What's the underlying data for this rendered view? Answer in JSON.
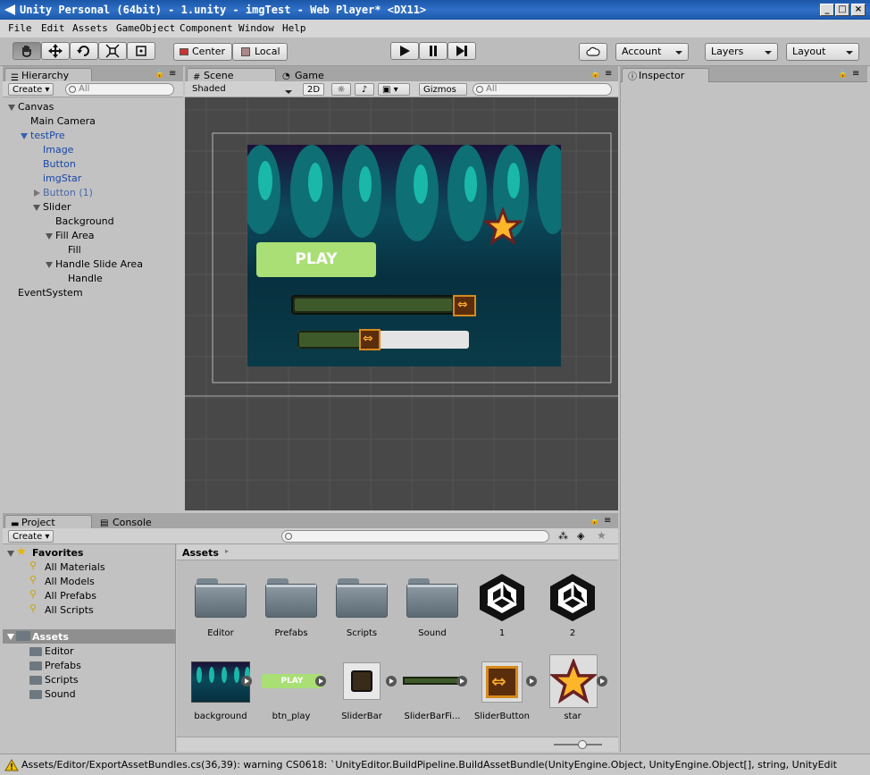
{
  "window": {
    "title": "Unity Personal (64bit) - 1.unity - imgTest - Web Player* <DX11>"
  },
  "menu": [
    "File",
    "Edit",
    "Assets",
    "GameObject",
    "Component",
    "Window",
    "Help"
  ],
  "toolbar": {
    "center": "Center",
    "local": "Local",
    "account": "Account",
    "layers": "Layers",
    "layout": "Layout"
  },
  "hierarchy": {
    "tab": "Hierarchy",
    "create": "Create",
    "search_placeholder": "All",
    "items": [
      "Canvas",
      "Main Camera",
      "testPre",
      "Image",
      "Button",
      "imgStar",
      "Button (1)",
      "Slider",
      "Background",
      "Fill Area",
      "Fill",
      "Handle Slide Area",
      "Handle",
      "EventSystem"
    ]
  },
  "scene": {
    "tab_scene": "Scene",
    "tab_game": "Game",
    "shading": "Shaded",
    "mode2d": "2D",
    "gizmos": "Gizmos",
    "search_placeholder": "All",
    "play_label": "PLAY"
  },
  "inspector": {
    "tab": "Inspector"
  },
  "project": {
    "tab_project": "Project",
    "tab_console": "Console",
    "create": "Create",
    "favorites_label": "Favorites",
    "favorites": [
      "All Materials",
      "All Models",
      "All Prefabs",
      "All Scripts"
    ],
    "assets_label": "Assets",
    "asset_folders": [
      "Editor",
      "Prefabs",
      "Scripts",
      "Sound"
    ],
    "breadcrumb": "Assets",
    "assets_row1": [
      "Editor",
      "Prefabs",
      "Scripts",
      "Sound",
      "1",
      "2"
    ],
    "assets_row2": [
      "background",
      "btn_play",
      "SliderBar",
      "SliderBarFi...",
      "SliderButton",
      "star"
    ],
    "btn_play_text": "PLAY"
  },
  "status": {
    "message": "Assets/Editor/ExportAssetBundles.cs(36,39): warning CS0618: `UnityEditor.BuildPipeline.BuildAssetBundle(UnityEngine.Object, UnityEngine.Object[], string, UnityEdit"
  },
  "colors": {
    "accent_blue": "#1a47a6",
    "title_blue": "#2f6fc7",
    "play_green": "#a9df75",
    "status_warn": "#f2c100"
  }
}
